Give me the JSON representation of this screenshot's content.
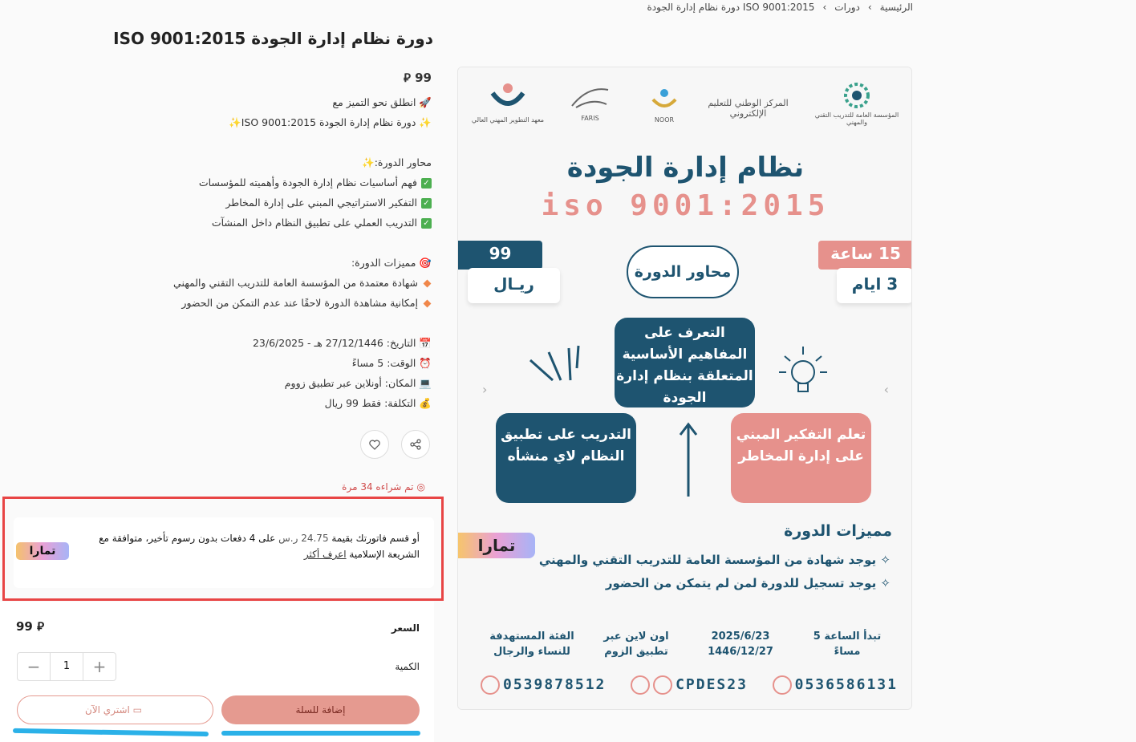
{
  "breadcrumb": {
    "home": "الرئيسية",
    "courses": "دورات",
    "current": "دورة نظام إدارة الجودة ISO 9001:2015"
  },
  "product": {
    "title": "دورة نظام إدارة الجودة ISO 9001:2015",
    "price_top": "99 ⃁",
    "desc": {
      "l1": "انطلق نحو التميز مع",
      "l2": "دورة نظام إدارة الجودة ISO 9001:2015",
      "l3": "محاور الدورة:",
      "l4": "فهم أساسيات نظام إدارة الجودة وأهميته للمؤسسات",
      "l5": "التفكير الاستراتيجي المبني على إدارة المخاطر",
      "l6": "التدريب العملي على تطبيق النظام داخل المنشآت",
      "l7": "مميزات الدورة:",
      "l8": "شهادة معتمدة من المؤسسة العامة للتدريب التقني والمهني",
      "l9": "إمكانية مشاهدة الدورة لاحقًا عند عدم التمكن من الحضور",
      "l10": "التاريخ: 27/12/1446 هـ - 23/6/2025",
      "l11": "الوقت: 5 مساءً",
      "l12": "المكان: أونلاين عبر تطبيق زووم",
      "l13": "التكلفة: فقط 99 ريال"
    },
    "sold": "تم شراءه 34 مرة"
  },
  "tamara": {
    "text_a": "أو قسم فاتورتك بقيمة",
    "amount": "24.75",
    "currency": "ر.س",
    "text_b": "على 4 دفعات بدون رسوم تأخير، متوافقة مع الشريعة الإسلامية",
    "learn_more": "اعرف أكثر",
    "logo": "تمارا"
  },
  "purchase": {
    "price_label": "السعر",
    "price_value": "99 ⃁",
    "qty_label": "الكمية",
    "qty_value": "1",
    "buy_now": "اشتري الآن",
    "add_to_cart": "إضافة للسلة"
  },
  "poster": {
    "logo1": "المؤسسة العامة للتدريب التقني والمهني",
    "logo2": "المركز الوطني للتعليم الإلكتروني",
    "logo3": "NOOR",
    "logo4": "FARIS",
    "logo5": "معهد التطوير المهني العالي",
    "title": "نظام إدارة الجودة",
    "subtitle": "iso 9001:2015",
    "price_num": "99",
    "price_unit": "ريـال",
    "hours": "15 ساعة",
    "days": "3 ايام",
    "axes": "محاور الدورة",
    "box_center": "التعرف على المفاهيم الأساسية المتعلقة بنظام إدارة الجودة",
    "box_left": "التدريب على تطبيق النظام لاي منشأه",
    "box_right": "تعلم التفكير المبني على إدارة المخاطر",
    "features_title": "مميزات الدورة",
    "feature1": "يوجد شهادة من المؤسسة العامة للتدريب التقني والمهني",
    "feature2": "يوجد تسجيل للدورة لمن لم يتمكن من الحضور",
    "tamara": "تمارا",
    "info_time": "تبدأ الساعة 5 مساءً",
    "info_date": "2025/6/23 1446/12/27",
    "info_place": "اون لاين عبر تطبيق الزوم",
    "info_target": "الفئة المستهدفة للنساء والرجال",
    "phone1": "0539878512",
    "handle": "CPDES23",
    "phone2": "0536586131"
  },
  "colors": {
    "navy": "#1e5470",
    "salmon": "#e6918c",
    "highlight": "#e84545",
    "scribble": "#2bb1e8"
  }
}
